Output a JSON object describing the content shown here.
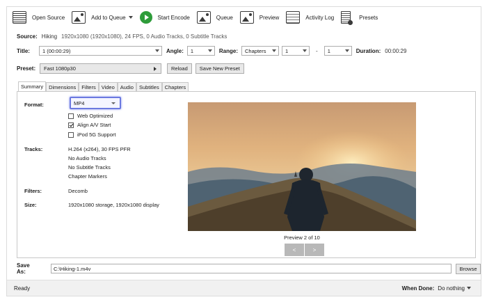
{
  "toolbar": {
    "open_source": "Open Source",
    "add_to_queue": "Add to Queue",
    "start_encode": "Start Encode",
    "queue": "Queue",
    "preview": "Preview",
    "activity_log": "Activity Log",
    "presets": "Presets"
  },
  "source": {
    "label": "Source:",
    "name": "Hiking",
    "details": "1920x1080 (1920x1080), 24 FPS, 0 Audio Tracks, 0 Subtitle Tracks"
  },
  "title_row": {
    "title_label": "Title:",
    "title_value": "1 (00:00:29)",
    "angle_label": "Angle:",
    "angle_value": "1",
    "range_label": "Range:",
    "range_type": "Chapters",
    "range_start": "1",
    "range_sep": "-",
    "range_end": "1",
    "duration_label": "Duration:",
    "duration_value": "00:00:29"
  },
  "preset_row": {
    "label": "Preset:",
    "value": "Fast 1080p30",
    "reload": "Reload",
    "save_new": "Save New Preset"
  },
  "tabs": [
    "Summary",
    "Dimensions",
    "Filters",
    "Video",
    "Audio",
    "Subtitles",
    "Chapters"
  ],
  "summary": {
    "format_label": "Format:",
    "format_value": "MP4",
    "options": [
      {
        "label": "Web Optimized",
        "checked": false
      },
      {
        "label": "Align A/V Start",
        "checked": true
      },
      {
        "label": "iPod 5G Support",
        "checked": false
      }
    ],
    "tracks_label": "Tracks:",
    "tracks": [
      "H.264 (x264), 30 FPS PFR",
      "No Audio Tracks",
      "No Subtitle Tracks",
      "Chapter Markers"
    ],
    "filters_label": "Filters:",
    "filters_value": "Decomb",
    "size_label": "Size:",
    "size_value": "1920x1080 storage, 1920x1080 display",
    "preview_caption": "Preview 2 of 10",
    "prev_btn": "<",
    "next_btn": ">"
  },
  "save_as": {
    "label": "Save As:",
    "value": "C:\\Hiking-1.m4v",
    "browse": "Browse"
  },
  "status": {
    "text": "Ready",
    "when_done_label": "When Done:",
    "when_done_value": "Do nothing"
  },
  "colors": {
    "accent_highlight": "#6b79e0",
    "encode_green": "#2e9c3a"
  }
}
